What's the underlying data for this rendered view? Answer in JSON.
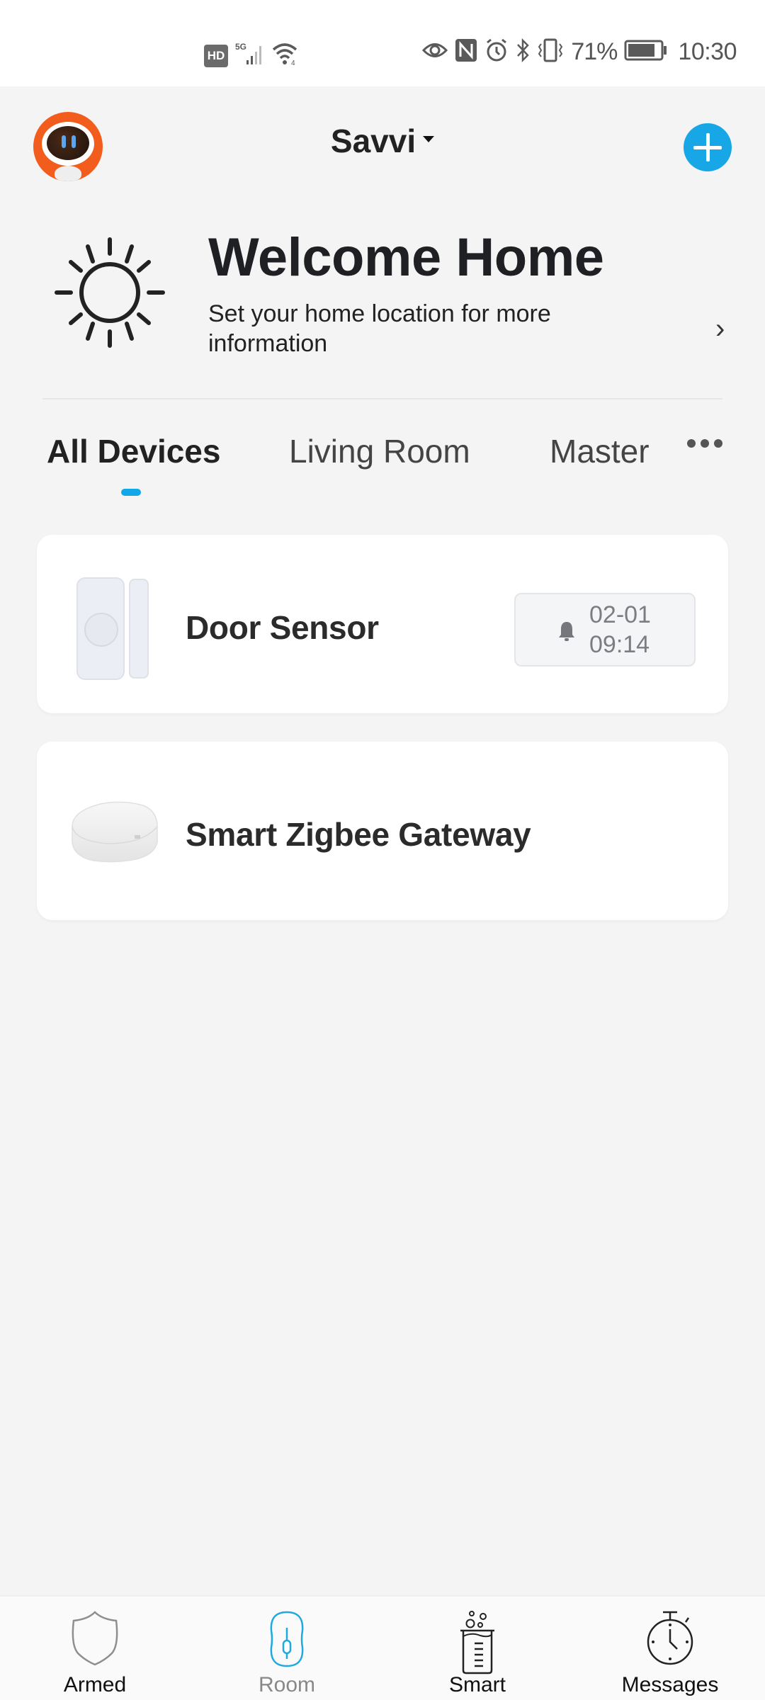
{
  "status_bar": {
    "hd_badge": "HD",
    "network": "5G",
    "battery_percent": "71%",
    "time": "10:30",
    "icons": [
      "hd-icon",
      "signal-5g-icon",
      "wifi-icon",
      "eye-icon",
      "nfc-icon",
      "alarm-icon",
      "bluetooth-icon",
      "vibrate-icon",
      "battery-icon"
    ]
  },
  "header": {
    "home_name": "Savvi",
    "avatar_icon": "robot-avatar-icon",
    "add_icon": "plus-icon"
  },
  "welcome": {
    "title": "Welcome Home",
    "subtitle": "Set your home location for more information",
    "icon": "sun-icon",
    "chevron": "›"
  },
  "tabs": [
    {
      "label": "All Devices",
      "active": true
    },
    {
      "label": "Living Room",
      "active": false
    },
    {
      "label": "Master",
      "active": false
    }
  ],
  "accent_color": "#12a7e8",
  "devices": [
    {
      "name": "Door Sensor",
      "image": "door-sensor-image",
      "alert": {
        "icon": "bell-icon",
        "date": "02-01",
        "time": "09:14"
      }
    },
    {
      "name": "Smart Zigbee Gateway",
      "image": "zigbee-gateway-image"
    }
  ],
  "bottom_nav": [
    {
      "label": "Armed",
      "icon": "shield-icon",
      "active": false
    },
    {
      "label": "Room",
      "icon": "room-icon",
      "active": true
    },
    {
      "label": "Smart",
      "icon": "beaker-icon",
      "active": false
    },
    {
      "label": "Messages",
      "icon": "stopwatch-icon",
      "active": false
    }
  ]
}
